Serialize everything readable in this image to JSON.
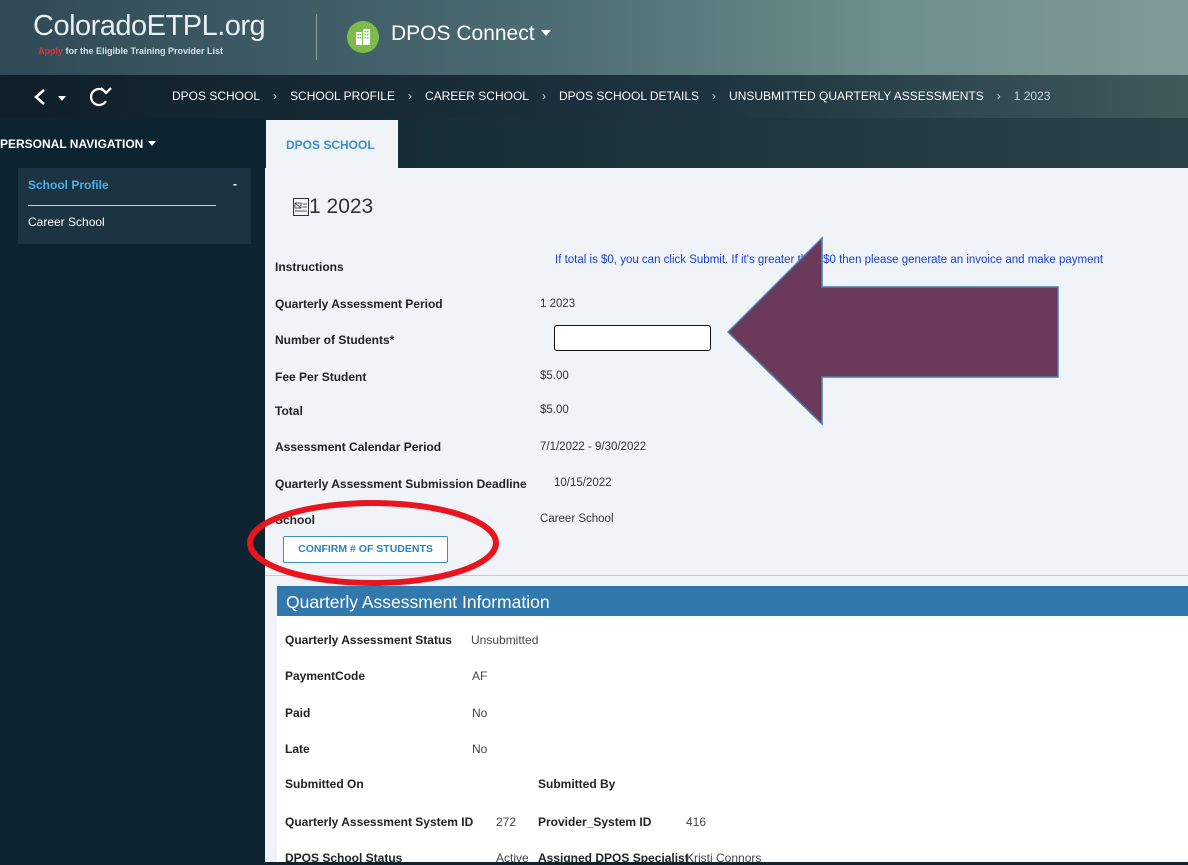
{
  "header": {
    "logo_main": "ColoradoETPL.org",
    "logo_apply": "Apply",
    "logo_rest": " for the Eligible Training Provider List",
    "app_title": "DPOS Connect"
  },
  "breadcrumb": [
    "DPOS SCHOOL",
    "SCHOOL PROFILE",
    "CAREER SCHOOL",
    "DPOS SCHOOL DETAILS",
    "UNSUBMITTED QUARTERLY ASSESSMENTS",
    "1 2023"
  ],
  "sidebar": {
    "title": "PERSONAL NAVIGATION",
    "section_label": "School Profile",
    "collapse_symbol": "-",
    "item": "Career School"
  },
  "tab": {
    "label": "DPOS SCHOOL"
  },
  "page": {
    "title": "1 2023"
  },
  "form": {
    "instructions_label": "Instructions",
    "instructions_text": "If total is $0, you can click Submit. If it's greater than $0 then please generate an invoice and make payment",
    "period_label": "Quarterly Assessment Period",
    "period_value": "1 2023",
    "students_label": "Number of Students*",
    "students_value": "",
    "fee_label": "Fee Per Student",
    "fee_value": "$5.00",
    "total_label": "Total",
    "total_value": "$5.00",
    "calendar_label": "Assessment Calendar Period",
    "calendar_value": "7/1/2022 - 9/30/2022",
    "deadline_label": "Quarterly Assessment Submission Deadline",
    "deadline_value": "10/15/2022",
    "school_label": "School",
    "school_value": "Career School",
    "confirm_button": "CONFIRM # OF STUDENTS"
  },
  "qa_info": {
    "header": "Quarterly Assessment Information",
    "status_label": "Quarterly Assessment Status",
    "status_value": "Unsubmitted",
    "payment_label": "PaymentCode",
    "payment_value": "AF",
    "paid_label": "Paid",
    "paid_value": "No",
    "late_label": "Late",
    "late_value": "No",
    "submitted_on_label": "Submitted On",
    "submitted_on_value": "",
    "submitted_by_label": "Submitted By",
    "submitted_by_value": "",
    "system_id_label": "Quarterly Assessment System ID",
    "system_id_value": "272",
    "provider_id_label": "Provider_System ID",
    "provider_id_value": "416",
    "school_status_label": "DPOS School Status",
    "school_status_value": "Active",
    "specialist_label": "Assigned DPOS Specialist",
    "specialist_value": "Kristi Connors"
  },
  "annotations": {
    "arrow_color": "#6b3a5a",
    "ellipse_color": "#e8141e"
  },
  "colors": {
    "accent_blue": "#3a8fc6",
    "header_bar": "#3178ad",
    "app_icon": "#7dbb4a",
    "link_blue": "#1a3fd6"
  }
}
